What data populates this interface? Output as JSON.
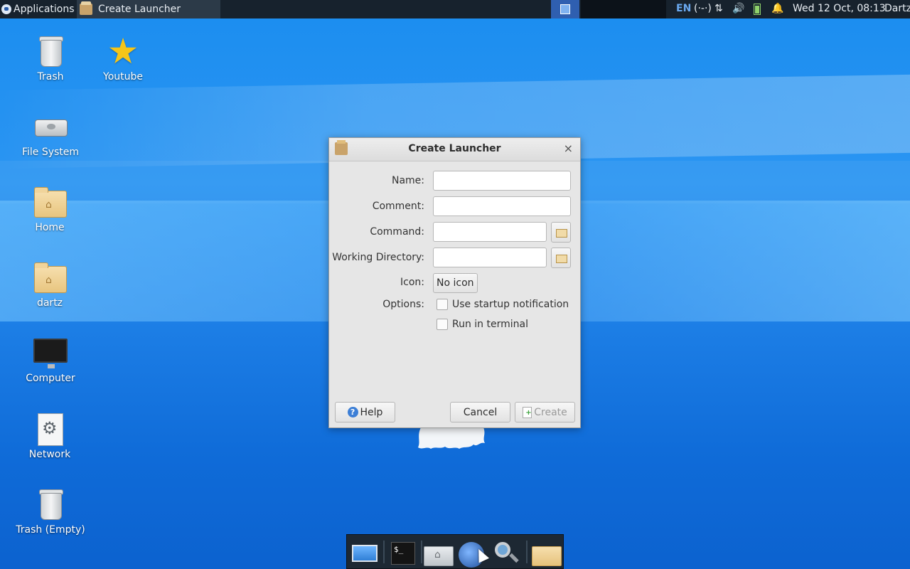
{
  "top_panel": {
    "applications_label": "Applications",
    "task_title": "Create Launcher",
    "lang": "EN",
    "net_symbol": "(·-·)",
    "updown_symbol": "⇅",
    "volume_symbol": "🔊",
    "bell_symbol": "🔔",
    "clock": "Wed 12 Oct, 08:13",
    "user": "Dartz"
  },
  "desktop_icons": [
    {
      "label": "Trash",
      "icon": "trash-icon"
    },
    {
      "label": "Youtube",
      "icon": "star-icon"
    },
    {
      "label": "File System",
      "icon": "harddrive-icon"
    },
    {
      "label": "Home",
      "icon": "home-folder-icon"
    },
    {
      "label": "dartz",
      "icon": "home-folder-icon"
    },
    {
      "label": "Computer",
      "icon": "monitor-icon"
    },
    {
      "label": "Network",
      "icon": "network-icon"
    },
    {
      "label": "Trash (Empty)",
      "icon": "trash-icon"
    }
  ],
  "dialog": {
    "title": "Create Launcher",
    "close_symbol": "×",
    "labels": {
      "name": "Name:",
      "comment": "Comment:",
      "command": "Command:",
      "working_directory": "Working Directory:",
      "icon": "Icon:",
      "options": "Options:"
    },
    "fields": {
      "name": "",
      "comment": "",
      "command": "",
      "working_directory": ""
    },
    "icon_button": "No icon",
    "options": {
      "startup_notification": {
        "label": "Use startup notification",
        "checked": false
      },
      "run_in_terminal": {
        "label": "Run in terminal",
        "checked": false
      }
    },
    "buttons": {
      "help": "Help",
      "cancel": "Cancel",
      "create": "Create"
    },
    "help_glyph": "?"
  },
  "dock": {
    "terminal_glyph": "$_",
    "items": [
      "show-desktop-icon",
      "terminal-icon",
      "home-folder-icon",
      "web-browser-icon",
      "search-icon",
      "files-icon"
    ]
  },
  "colors": {
    "panel_bg": "#17222d",
    "desktop_blue": "#1f7fe8",
    "dialog_bg": "#e6e6e6",
    "workspace_active": "#2f5fb0"
  }
}
